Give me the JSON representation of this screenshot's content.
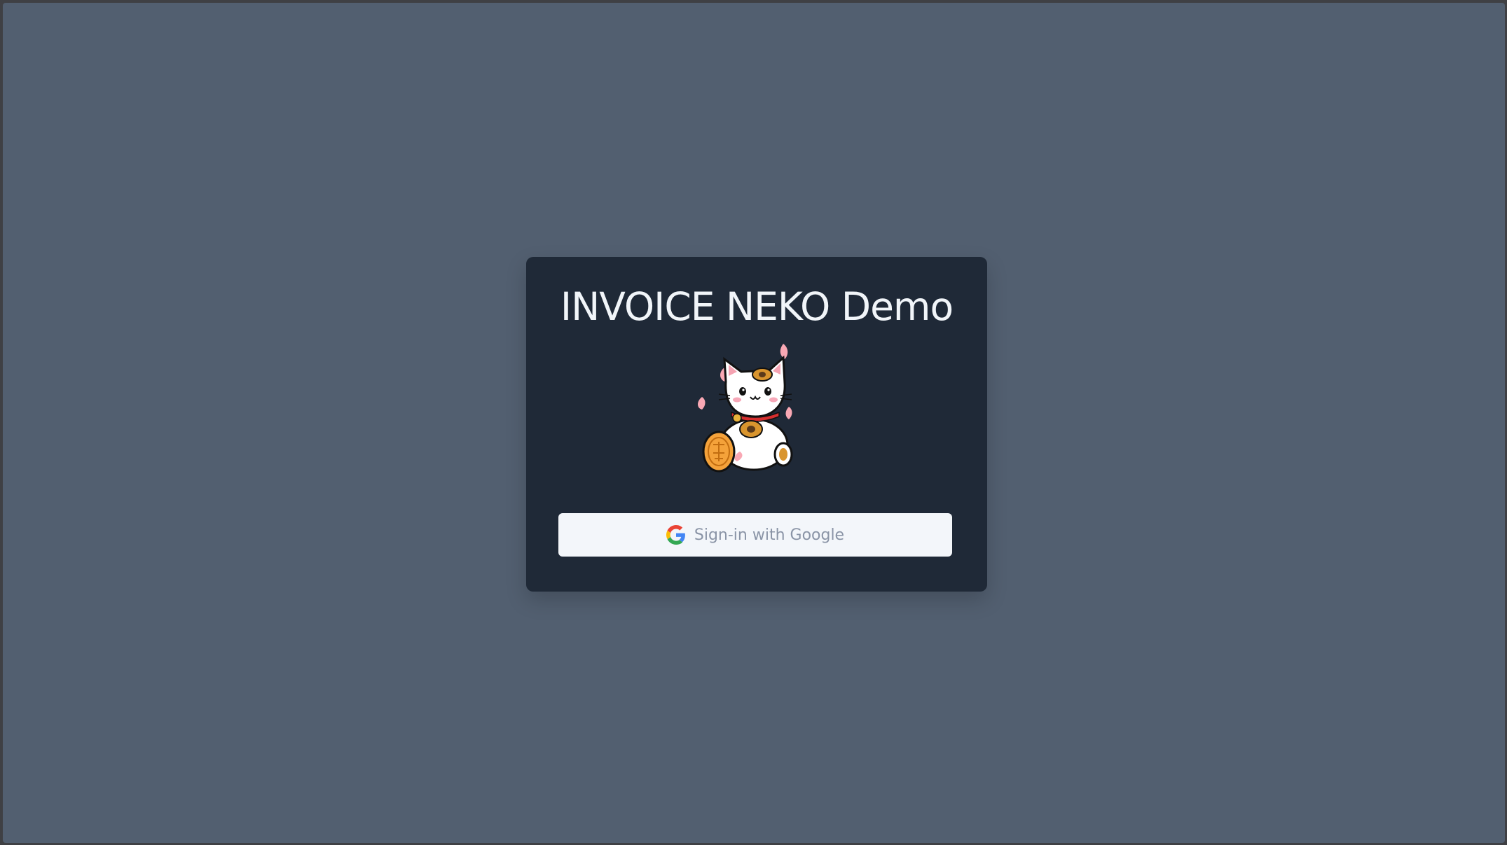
{
  "login": {
    "title": "INVOICE NEKO Demo",
    "mascot_icon": "maneki-neko-cat-icon",
    "signin_label": "Sign-in with Google",
    "signin_icon": "google-icon"
  },
  "colors": {
    "page_background": "#525f70",
    "card_background": "#1f2937",
    "title_text": "#f1f5f9",
    "button_background": "#f3f6fa",
    "button_text": "#8a94a6"
  }
}
